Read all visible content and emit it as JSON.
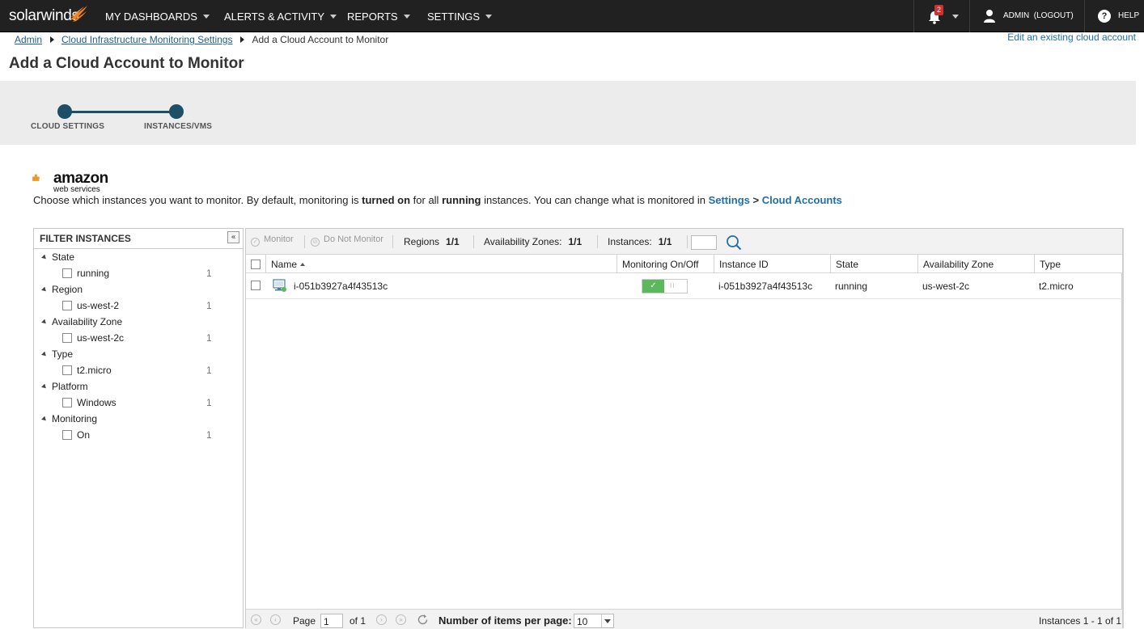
{
  "brand": {
    "logo_text": "solarwinds"
  },
  "topnav": {
    "items": [
      {
        "label": "MY DASHBOARDS"
      },
      {
        "label": "ALERTS & ACTIVITY"
      },
      {
        "label": "REPORTS"
      },
      {
        "label": "SETTINGS"
      }
    ],
    "notification_count": "2",
    "user_label": "ADMIN  (LOGOUT)",
    "help_label": "HELP"
  },
  "breadcrumb": {
    "items": [
      "Admin",
      "Cloud Infrastructure Monitoring Settings"
    ],
    "current": "Add a Cloud Account to Monitor"
  },
  "edit_link": "Edit an existing cloud account",
  "page_title": "Add a Cloud Account to Monitor",
  "wizard": {
    "steps": [
      "CLOUD SETTINGS",
      "INSTANCES/VMS"
    ]
  },
  "aws": {
    "logo_text": "amazon",
    "logo_sub": "web services",
    "desc_1": "Choose which instances you want to monitor. By default, monitoring is ",
    "desc_b1": "turned on",
    "desc_2": " for all ",
    "desc_b2": "running",
    "desc_3": " instances. You can change what is monitored in ",
    "link_settings": "Settings",
    "link_sep": " > ",
    "link_accounts": "Cloud Accounts"
  },
  "filter": {
    "title": "FILTER INSTANCES",
    "groups": [
      {
        "label": "State",
        "item": "running",
        "count": "1"
      },
      {
        "label": "Region",
        "item": "us-west-2",
        "count": "1"
      },
      {
        "label": "Availability Zone",
        "item": "us-west-2c",
        "count": "1"
      },
      {
        "label": "Type",
        "item": "t2.micro",
        "count": "1"
      },
      {
        "label": "Platform",
        "item": "Windows",
        "count": "1"
      },
      {
        "label": "Monitoring",
        "item": "On",
        "count": "1"
      }
    ]
  },
  "toolbar": {
    "monitor": "Monitor",
    "do_not_monitor": "Do Not Monitor",
    "regions_label": "Regions",
    "regions_value": "1/1",
    "az_label": "Availability Zones:",
    "az_value": "1/1",
    "instances_label": "Instances:",
    "instances_value": "1/1"
  },
  "table": {
    "columns": [
      "Name",
      "Monitoring On/Off",
      "Instance ID",
      "State",
      "Availability Zone",
      "Type"
    ],
    "rows": [
      {
        "name": "i-051b3927a4f43513c",
        "monitoring": true,
        "instance_id": "i-051b3927a4f43513c",
        "state": "running",
        "az": "us-west-2c",
        "type": "t2.micro"
      }
    ]
  },
  "pager": {
    "page_label": "Page",
    "page_value": "1",
    "of_label": "of 1",
    "per_page_label": "Number of items per page:",
    "per_page_value": "10",
    "summary": "Instances 1 - 1 of 1"
  },
  "colors": {
    "accent": "#1d4f66",
    "toggle_on": "#5cb85c",
    "badge": "#d0312d",
    "nav_bg": "#212121"
  }
}
